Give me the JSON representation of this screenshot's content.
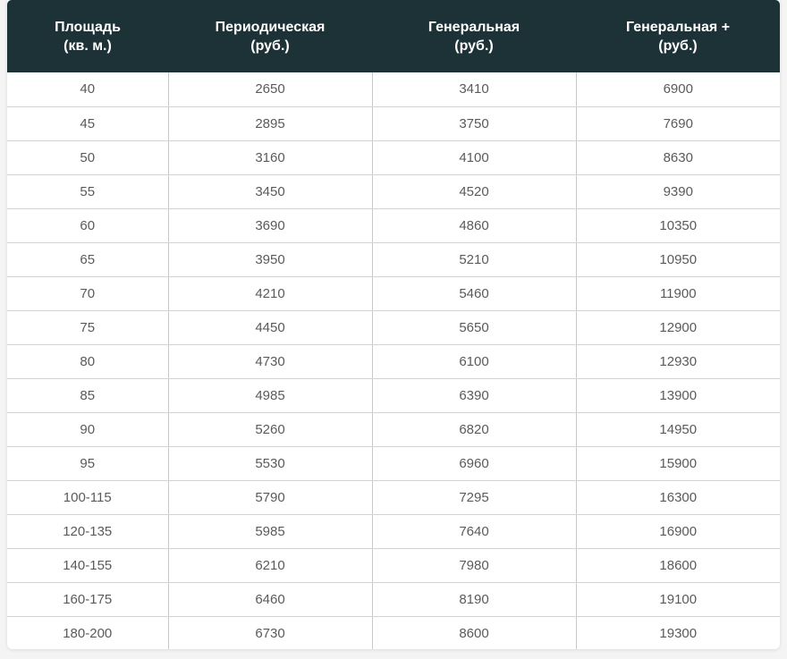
{
  "table": {
    "headers": [
      {
        "line1": "Площадь",
        "line2": "(кв. м.)"
      },
      {
        "line1": "Периодическая",
        "line2": "(руб.)"
      },
      {
        "line1": "Генеральная",
        "line2": "(руб.)"
      },
      {
        "line1": "Генеральная +",
        "line2": "(руб.)"
      }
    ],
    "rows": [
      [
        "40",
        "2650",
        "3410",
        "6900"
      ],
      [
        "45",
        "2895",
        "3750",
        "7690"
      ],
      [
        "50",
        "3160",
        "4100",
        "8630"
      ],
      [
        "55",
        "3450",
        "4520",
        "9390"
      ],
      [
        "60",
        "3690",
        "4860",
        "10350"
      ],
      [
        "65",
        "3950",
        "5210",
        "10950"
      ],
      [
        "70",
        "4210",
        "5460",
        "11900"
      ],
      [
        "75",
        "4450",
        "5650",
        "12900"
      ],
      [
        "80",
        "4730",
        "6100",
        "12930"
      ],
      [
        "85",
        "4985",
        "6390",
        "13900"
      ],
      [
        "90",
        "5260",
        "6820",
        "14950"
      ],
      [
        "95",
        "5530",
        "6960",
        "15900"
      ],
      [
        "100-115",
        "5790",
        "7295",
        "16300"
      ],
      [
        "120-135",
        "5985",
        "7640",
        "16900"
      ],
      [
        "140-155",
        "6210",
        "7980",
        "18600"
      ],
      [
        "160-175",
        "6460",
        "8190",
        "19100"
      ],
      [
        "180-200",
        "6730",
        "8600",
        "19300"
      ]
    ]
  },
  "colors": {
    "header_bg": "#1c3236",
    "header_text": "#ffffff",
    "cell_text": "#5a5a5a",
    "grid": "#d3d3d3"
  }
}
